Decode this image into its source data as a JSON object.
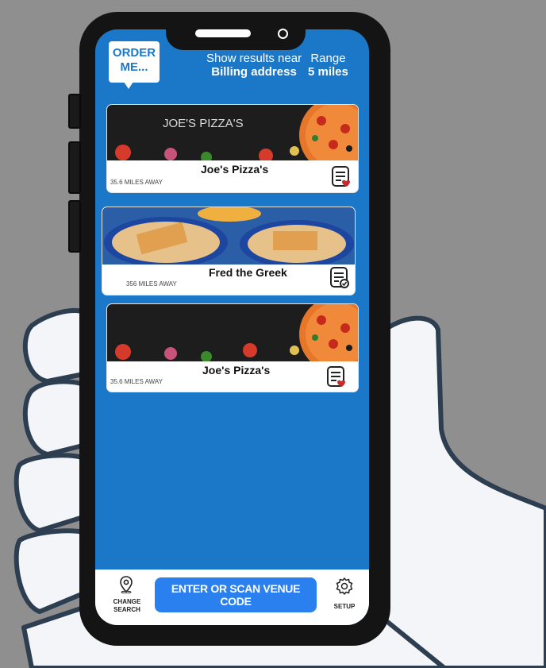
{
  "app": {
    "logo_line1": "ORDER",
    "logo_line2": "ME..."
  },
  "header": {
    "results_label": "Show results near",
    "results_value": "Billing address",
    "range_label": "Range",
    "range_value": "5 miles"
  },
  "venues": [
    {
      "image_title": "JOE'S PIZZA'S",
      "name": "Joe's Pizza's",
      "distance": "35.6 MILES AWAY"
    },
    {
      "image_title": "",
      "name": "Fred the Greek",
      "distance": "356 MILES AWAY"
    },
    {
      "image_title": "",
      "name": "Joe's Pizza's",
      "distance": "35.6 MILES AWAY"
    }
  ],
  "bottom_bar": {
    "change_search_line1": "CHANGE",
    "change_search_line2": "SEARCH",
    "scan_button": "ENTER OR SCAN VENUE CODE",
    "setup": "SETUP"
  },
  "icons": [
    "location-pin-icon",
    "gear-icon",
    "menu-heart-icon",
    "menu-check-icon"
  ],
  "colors": {
    "screen_blue": "#1b78c9",
    "button_blue": "#2b80f0",
    "background": "#8f8f8f"
  }
}
